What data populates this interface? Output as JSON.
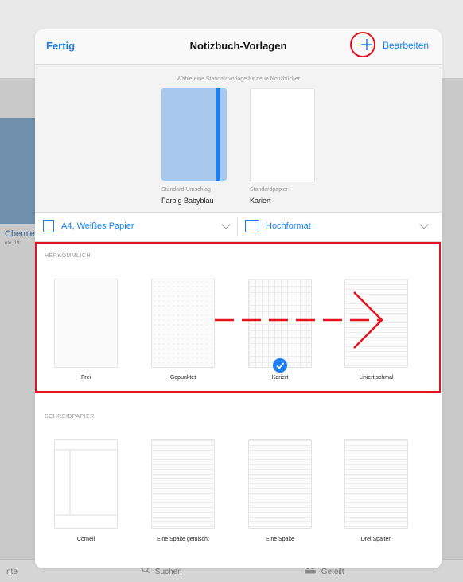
{
  "background": {
    "notebook_title": "Chemie",
    "notebook_subtitle": "ute, 19:",
    "tabs": [
      {
        "label": "nte",
        "icon": ""
      },
      {
        "label": "Suchen",
        "icon": "search-icon"
      },
      {
        "label": "Geteilt",
        "icon": "shared-people-icon"
      }
    ]
  },
  "navbar": {
    "done_label": "Fertig",
    "title": "Notizbuch-Vorlagen",
    "add_icon": "plus-icon",
    "edit_label": "Bearbeiten"
  },
  "defaults": {
    "hint": "Wähle eine Standardvorlage für neue Notizbücher",
    "cover": {
      "caption": "Standard-Umschlag",
      "value": "Farbig Babyblau",
      "color": "#a9c8ee",
      "band_color": "#1b7ef5"
    },
    "paper": {
      "caption": "Standardpapier",
      "value": "Kariert"
    }
  },
  "selectors": {
    "paper_size": "A4, Weißes Papier",
    "orientation": "Hochformat"
  },
  "sections": [
    {
      "title": "HERKÖMMLICH",
      "templates": [
        {
          "label": "Frei"
        },
        {
          "label": "Gepunktet"
        },
        {
          "label": "Kariert",
          "selected": true
        },
        {
          "label": "Liniert schmal"
        }
      ]
    },
    {
      "title": "SCHREIBPAPIER",
      "templates": [
        {
          "label": "Cornell"
        },
        {
          "label": "Eine Spalte gemischt"
        },
        {
          "label": "Eine Spalte"
        },
        {
          "label": "Drei Spalten"
        }
      ]
    }
  ],
  "colors": {
    "accent": "#1b7ef5",
    "annotation": "#e3141f"
  }
}
